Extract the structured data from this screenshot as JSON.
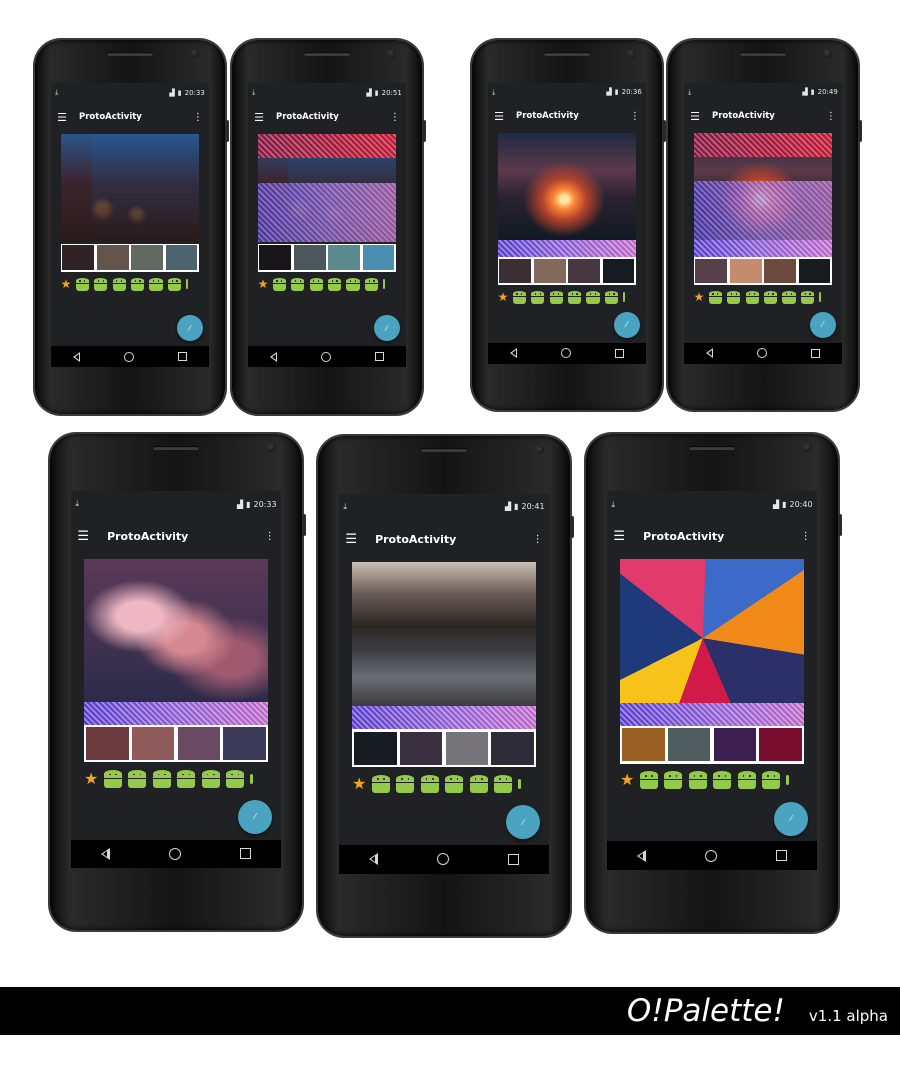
{
  "app_title": "ProtoActivity",
  "footer": {
    "brand": "O!Palette!",
    "version": "v1.1 alpha"
  },
  "icons": {
    "menu": "hamburger-icon",
    "overflow": "more-vert-icon",
    "download": "download-icon",
    "signal": "signal-icon",
    "battery": "battery-icon",
    "favorite": "star-icon",
    "droid": "android-icon",
    "fab": "fab-icon",
    "back": "back-icon",
    "home": "home-icon",
    "recents": "recents-icon"
  },
  "phones": [
    {
      "time": "20:33",
      "overlay": "none",
      "photo": "city-night",
      "swatches": [
        "#2f2124",
        "#65544a",
        "#606a60",
        "#4b6470"
      ]
    },
    {
      "time": "20:51",
      "overlay": "red-top-purple-bottom",
      "photo": "city-night",
      "swatches": [
        "#19161b",
        "#4b565d",
        "#5a8a8e",
        "#4a8fb0"
      ]
    },
    {
      "time": "20:36",
      "overlay": "purple-band",
      "photo": "sunset-sea",
      "swatches": [
        "#3b2f34",
        "#83695b",
        "#463742",
        "#161a22"
      ]
    },
    {
      "time": "20:49",
      "overlay": "red-top-purple-bottom",
      "photo": "sunset-sea",
      "swatches": [
        "#55404a",
        "#c48b6e",
        "#6c4a3e",
        "#181b1f"
      ]
    },
    {
      "time": "20:33",
      "overlay": "purple-band",
      "photo": "pink-clouds",
      "swatches": [
        "#6a3a3c",
        "#8f5a5a",
        "#6a4a62",
        "#3c3a5a"
      ]
    },
    {
      "time": "20:41",
      "overlay": "purple-band",
      "photo": "cobblestone-street",
      "swatches": [
        "#171b22",
        "#3a3040",
        "#77737a",
        "#2e2c39"
      ]
    },
    {
      "time": "20:40",
      "overlay": "purple-band",
      "photo": "abstract-shards",
      "swatches": [
        "#9a6023",
        "#4f5d60",
        "#3c1f50",
        "#7a0c30"
      ]
    }
  ]
}
